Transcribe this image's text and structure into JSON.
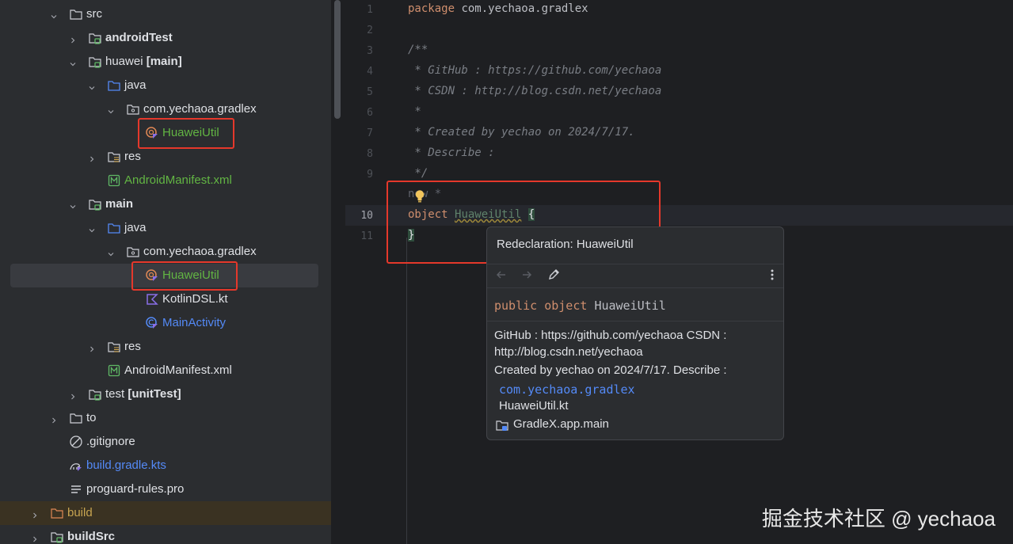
{
  "tree": {
    "items": [
      {
        "label": "src",
        "bold": "",
        "kind": "folder",
        "depth": 0,
        "expanded": true,
        "color": "#dfe1e5"
      },
      {
        "label": "androidTest",
        "bold": "",
        "kind": "module",
        "depth": 1,
        "expanded": false,
        "color": "#dfe1e5",
        "allBold": true
      },
      {
        "label": "huawei ",
        "bold": "[main]",
        "kind": "module",
        "depth": 1,
        "expanded": true,
        "color": "#dfe1e5"
      },
      {
        "label": "java",
        "bold": "",
        "kind": "src",
        "depth": 2,
        "expanded": true,
        "color": "#dfe1e5"
      },
      {
        "label": "com.yechaoa.gradlex",
        "bold": "",
        "kind": "package",
        "depth": 3,
        "expanded": true,
        "color": "#dfe1e5"
      },
      {
        "label": "HuaweiUtil",
        "bold": "",
        "kind": "kotlin-object",
        "depth": 4,
        "color": "#62b543"
      },
      {
        "label": "res",
        "bold": "",
        "kind": "res",
        "depth": 2,
        "expanded": false,
        "color": "#dfe1e5"
      },
      {
        "label": "AndroidManifest.xml",
        "bold": "",
        "kind": "manifest",
        "depth": 2,
        "color": "#62b543"
      },
      {
        "label": "main",
        "bold": "",
        "kind": "module",
        "depth": 1,
        "expanded": true,
        "color": "#dfe1e5",
        "allBold": true
      },
      {
        "label": "java",
        "bold": "",
        "kind": "src",
        "depth": 2,
        "expanded": true,
        "color": "#dfe1e5"
      },
      {
        "label": "com.yechaoa.gradlex",
        "bold": "",
        "kind": "package",
        "depth": 3,
        "expanded": true,
        "color": "#dfe1e5"
      },
      {
        "label": "HuaweiUtil",
        "bold": "",
        "kind": "kotlin-object",
        "depth": 4,
        "color": "#62b543",
        "selected": true
      },
      {
        "label": "KotlinDSL.kt",
        "bold": "",
        "kind": "kotlin-file",
        "depth": 4,
        "color": "#dfe1e5"
      },
      {
        "label": "MainActivity",
        "bold": "",
        "kind": "kotlin-class",
        "depth": 4,
        "color": "#548af7"
      },
      {
        "label": "res",
        "bold": "",
        "kind": "res",
        "depth": 2,
        "expanded": false,
        "color": "#dfe1e5"
      },
      {
        "label": "AndroidManifest.xml",
        "bold": "",
        "kind": "manifest",
        "depth": 2,
        "color": "#dfe1e5"
      },
      {
        "label": "test ",
        "bold": "[unitTest]",
        "kind": "module",
        "depth": 1,
        "expanded": false,
        "color": "#dfe1e5"
      },
      {
        "label": "to",
        "bold": "",
        "kind": "folder",
        "depth": 0,
        "expanded": false,
        "color": "#dfe1e5"
      },
      {
        "label": ".gitignore",
        "bold": "",
        "kind": "ignore",
        "depth": 0,
        "color": "#dfe1e5"
      },
      {
        "label": "build.gradle.kts",
        "bold": "",
        "kind": "gradle",
        "depth": 0,
        "color": "#548af7"
      },
      {
        "label": "proguard-rules.pro",
        "bold": "",
        "kind": "text",
        "depth": 0,
        "color": "#dfe1e5"
      },
      {
        "label": "build",
        "bold": "",
        "kind": "folder-excluded",
        "depth": -1,
        "expanded": false,
        "color": "#c7a450",
        "highlight": true
      },
      {
        "label": "buildSrc",
        "bold": "",
        "kind": "module",
        "depth": -1,
        "expanded": false,
        "color": "#dfe1e5",
        "allBold": true
      }
    ]
  },
  "editor": {
    "lines": [
      {
        "n": "1",
        "segs": [
          [
            "kw",
            "package "
          ],
          [
            "id",
            "com.yechaoa.gradlex"
          ]
        ]
      },
      {
        "n": "2",
        "segs": []
      },
      {
        "n": "3",
        "segs": [
          [
            "cm",
            "/**"
          ]
        ]
      },
      {
        "n": "4",
        "segs": [
          [
            "cm",
            " * GitHub : https://github.com/yechaoa"
          ]
        ]
      },
      {
        "n": "5",
        "segs": [
          [
            "cm",
            " * CSDN : http://blog.csdn.net/yechaoa"
          ]
        ]
      },
      {
        "n": "6",
        "segs": [
          [
            "cm",
            " *"
          ]
        ]
      },
      {
        "n": "7",
        "segs": [
          [
            "cm",
            " * Created by yechao on 2024/7/17."
          ]
        ]
      },
      {
        "n": "8",
        "segs": [
          [
            "cm",
            " * Describe :"
          ]
        ]
      },
      {
        "n": "9",
        "segs": [
          [
            "cm",
            " */"
          ]
        ]
      },
      {
        "n": "",
        "segs": [
          [
            "dim",
            "new *"
          ]
        ]
      },
      {
        "n": "10",
        "segs": [
          [
            "kw",
            "object "
          ],
          [
            "idx",
            "HuaweiUtil"
          ],
          [
            "id",
            " "
          ],
          [
            "brace",
            "{"
          ]
        ]
      },
      {
        "n": "11",
        "segs": [
          [
            "brace",
            "}"
          ]
        ]
      }
    ],
    "current_line": "10"
  },
  "popup": {
    "title": "Redeclaration: HuaweiUtil",
    "signature_kw": "public object ",
    "signature_name": "HuaweiUtil",
    "doc_line1": "GitHub : https://github.com/yechaoa CSDN :",
    "doc_line2": "http://blog.csdn.net/yechaoa",
    "doc_line3": "Created by yechao on 2024/7/17. Describe :",
    "package": "com.yechaoa.gradlex",
    "file": "HuaweiUtil.kt",
    "module": "GradleX.app.main"
  },
  "watermark": "掘金技术社区 @ yechaoa",
  "colors": {
    "accent": "#548af7",
    "error_box": "#e5382b",
    "kotlin_object": "#62b543",
    "keyword": "#cf8e6d",
    "comment": "#7a7e85"
  }
}
